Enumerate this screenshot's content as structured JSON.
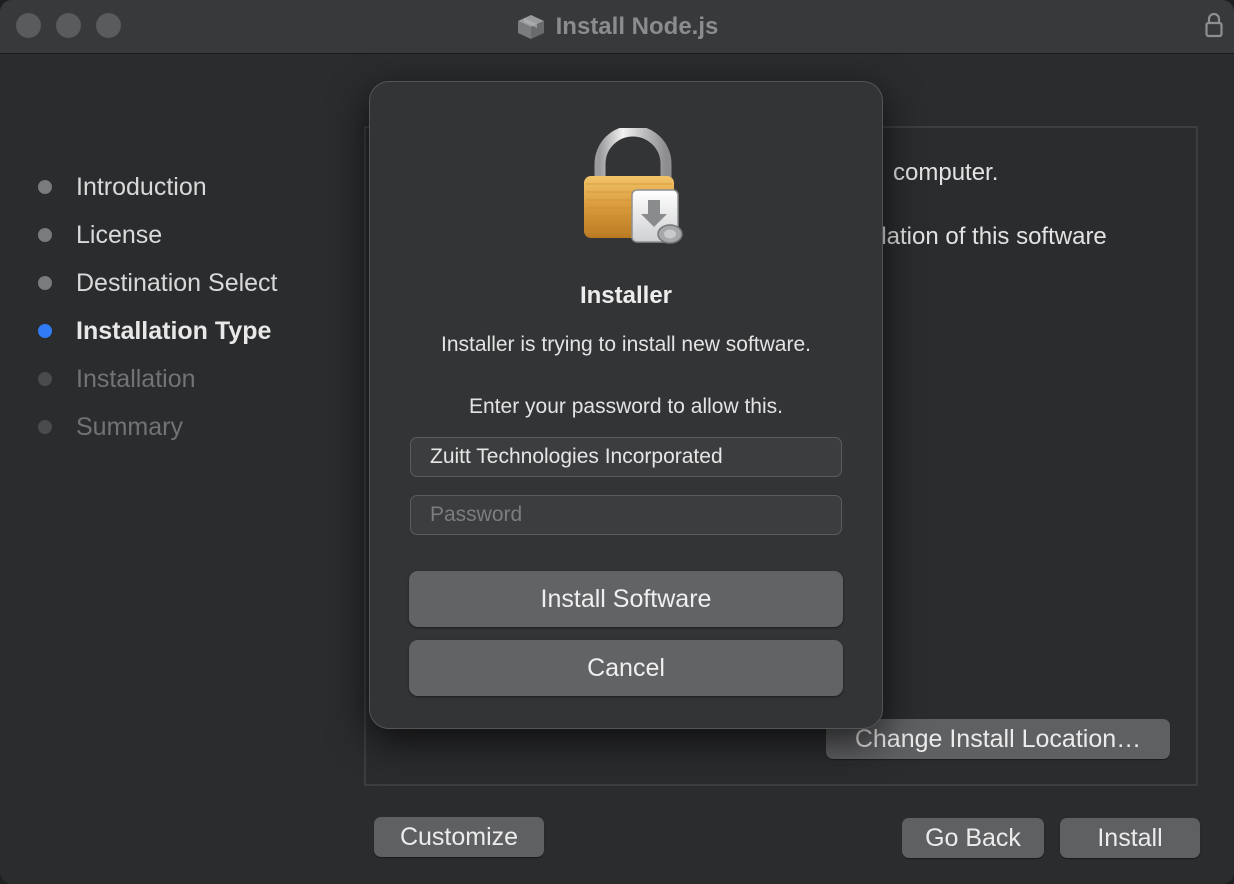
{
  "window": {
    "title": "Install Node.js"
  },
  "steps": [
    {
      "label": "Introduction",
      "state": "done"
    },
    {
      "label": "License",
      "state": "done"
    },
    {
      "label": "Destination Select",
      "state": "done"
    },
    {
      "label": "Installation Type",
      "state": "active"
    },
    {
      "label": "Installation",
      "state": "future"
    },
    {
      "label": "Summary",
      "state": "future"
    }
  ],
  "main": {
    "line1": "computer.",
    "line2": "llation of this software",
    "change_location_label": "Change Install Location…"
  },
  "footer": {
    "customize_label": "Customize",
    "go_back_label": "Go Back",
    "install_label": "Install"
  },
  "dialog": {
    "title": "Installer",
    "message": "Installer is trying to install new software.",
    "prompt": "Enter your password to allow this.",
    "username_value": "Zuitt Technologies Incorporated",
    "password_placeholder": "Password",
    "install_software_label": "Install Software",
    "cancel_label": "Cancel"
  },
  "colors": {
    "accent": "#2f7cf6"
  },
  "icons": {
    "title_icon": "package-icon",
    "titlebar_lock": "lock-icon",
    "dialog_icon": "padlock-installer-icon"
  }
}
